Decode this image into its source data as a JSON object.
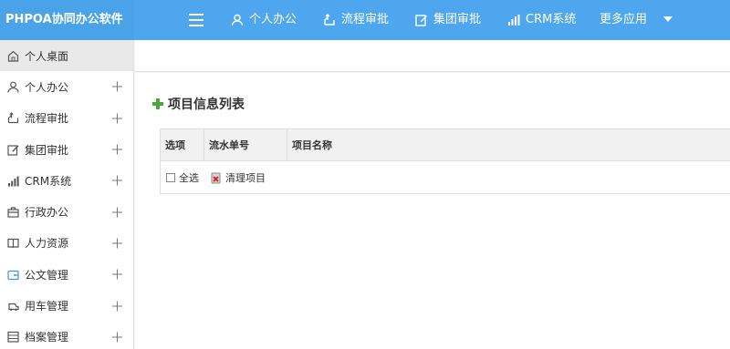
{
  "app": {
    "title": "PHPOA协同办公软件"
  },
  "topnav": {
    "items": [
      {
        "label": "个人办公",
        "icon": "user-icon"
      },
      {
        "label": "流程审批",
        "icon": "flow-icon"
      },
      {
        "label": "集团审批",
        "icon": "edit-icon"
      },
      {
        "label": "CRM系统",
        "icon": "bar-chart-icon"
      },
      {
        "label": "更多应用",
        "icon": "chevron-down-icon"
      }
    ]
  },
  "sidebar": {
    "items": [
      {
        "label": "个人桌面",
        "icon": "home-icon",
        "active": true
      },
      {
        "label": "个人办公",
        "icon": "user-icon"
      },
      {
        "label": "流程审批",
        "icon": "flow-icon"
      },
      {
        "label": "集团审批",
        "icon": "edit-icon"
      },
      {
        "label": "CRM系统",
        "icon": "bar-chart-icon"
      },
      {
        "label": "行政办公",
        "icon": "briefcase-icon"
      },
      {
        "label": "人力资源",
        "icon": "book-icon"
      },
      {
        "label": "公文管理",
        "icon": "folder-icon"
      },
      {
        "label": "用车管理",
        "icon": "car-icon"
      },
      {
        "label": "档案管理",
        "icon": "archive-icon"
      }
    ]
  },
  "main": {
    "panel_title": "项目信息列表",
    "table": {
      "headers": [
        "选项",
        "流水单号",
        "项目名称"
      ],
      "select_all_label": "全选",
      "clean_button_label": "清理项目"
    }
  },
  "colors": {
    "topbar": "#4ea7ee",
    "brand_bg": "#4aa2e8",
    "accent_green": "#49a83b"
  }
}
